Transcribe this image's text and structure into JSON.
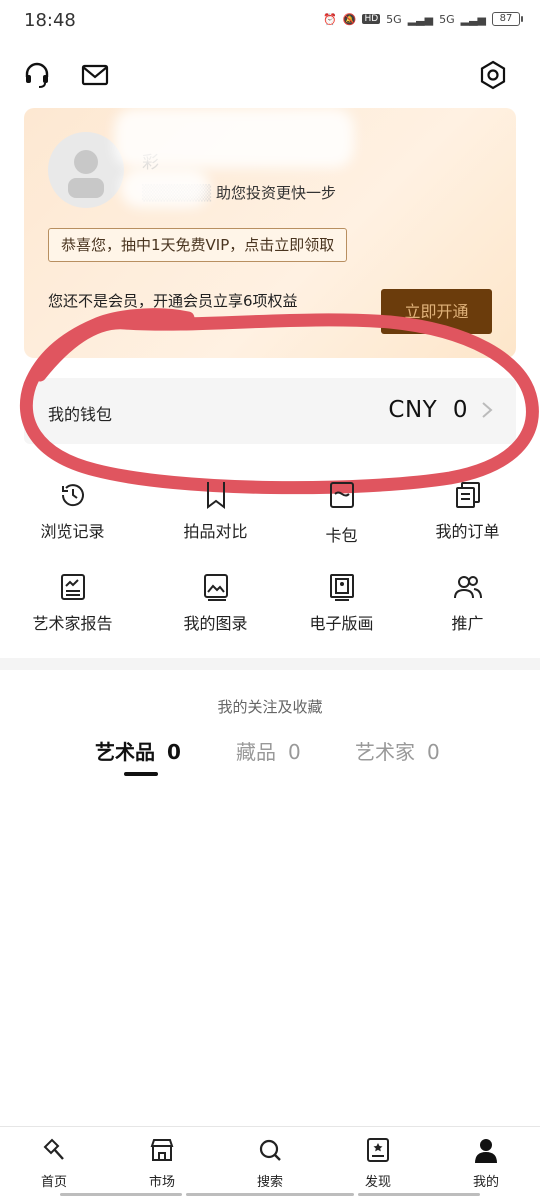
{
  "status_bar": {
    "time": "18:48",
    "hd": "HD",
    "net1": "5G",
    "net2": "5G",
    "battery": "87"
  },
  "profile": {
    "username": "彩",
    "tagline": "助您投资更快一步",
    "vip_banner": "恭喜您，抽中1天免费VIP，点击立即领取",
    "promo_text": "您还不是会员，开通会员立享6项权益",
    "open_button": "立即开通"
  },
  "wallet": {
    "label": "我的钱包",
    "currency": "CNY",
    "amount": "0",
    "display": "CNY  0"
  },
  "grid": [
    {
      "label": "浏览记录",
      "icon": "history-icon"
    },
    {
      "label": "拍品对比",
      "icon": "bookmark-icon"
    },
    {
      "label": "卡包",
      "icon": "card-icon"
    },
    {
      "label": "我的订单",
      "icon": "order-icon"
    },
    {
      "label": "艺术家报告",
      "icon": "report-icon"
    },
    {
      "label": "我的图录",
      "icon": "catalog-icon"
    },
    {
      "label": "电子版画",
      "icon": "print-icon"
    },
    {
      "label": "推广",
      "icon": "users-icon"
    }
  ],
  "favorites": {
    "title": "我的关注及收藏",
    "tabs": [
      {
        "label": "艺术品",
        "count": "0"
      },
      {
        "label": "藏品",
        "count": "0"
      },
      {
        "label": "艺术家",
        "count": "0"
      }
    ]
  },
  "nav": [
    {
      "label": "首页",
      "icon": "hammer-icon"
    },
    {
      "label": "市场",
      "icon": "store-icon"
    },
    {
      "label": "搜索",
      "icon": "search-icon"
    },
    {
      "label": "发现",
      "icon": "discover-icon"
    },
    {
      "label": "我的",
      "icon": "profile-icon"
    }
  ],
  "colors": {
    "accent": "#6b3c0c",
    "annotation": "#e0555f",
    "card_bg": "#fde8d2"
  }
}
